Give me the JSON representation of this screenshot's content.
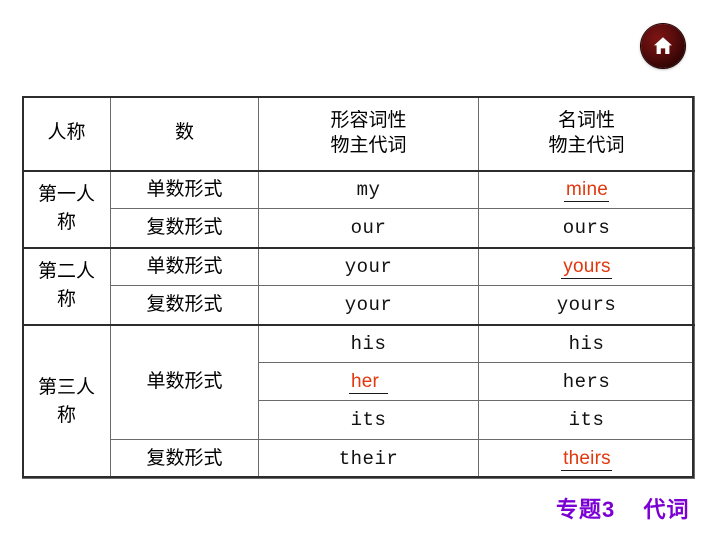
{
  "home_button": {
    "icon": "home-icon",
    "color": "#5d0d0d"
  },
  "table": {
    "headers": [
      "人称",
      "数",
      "形容词性\n物主代词",
      "名词性\n物主代词"
    ],
    "header_lines": {
      "col3_line1": "形容词性",
      "col3_line2": "物主代词",
      "col4_line1": "名词性",
      "col4_line2": "物主代词"
    },
    "groups": [
      {
        "person": "第一人称",
        "rows": [
          {
            "number": "单数形式",
            "adjective": "my",
            "adj_highlight": false,
            "nominal": "mine",
            "nom_highlight": true
          },
          {
            "number": "复数形式",
            "adjective": "our",
            "adj_highlight": false,
            "nominal": "ours",
            "nom_highlight": false
          }
        ]
      },
      {
        "person": "第二人称",
        "rows": [
          {
            "number": "单数形式",
            "adjective": "your",
            "adj_highlight": false,
            "nominal": "yours",
            "nom_highlight": true
          },
          {
            "number": "复数形式",
            "adjective": "your",
            "adj_highlight": false,
            "nominal": "yours",
            "nom_highlight": false
          }
        ]
      },
      {
        "person": "第三人称",
        "rows": [
          {
            "number": "单数形式",
            "adjective": "his",
            "adj_highlight": false,
            "nominal": "his",
            "nom_highlight": false
          },
          {
            "number": "",
            "adjective": "her",
            "adj_highlight": true,
            "nominal": "hers",
            "nom_highlight": false
          },
          {
            "number": "",
            "adjective": "its",
            "adj_highlight": false,
            "nominal": "its",
            "nom_highlight": false
          },
          {
            "number": "复数形式",
            "adjective": "their",
            "adj_highlight": false,
            "nominal": "theirs",
            "nom_highlight": true
          }
        ]
      }
    ]
  },
  "footer": {
    "topic_label": "专题3",
    "topic_name": "代词",
    "color": "#7b00d4"
  }
}
